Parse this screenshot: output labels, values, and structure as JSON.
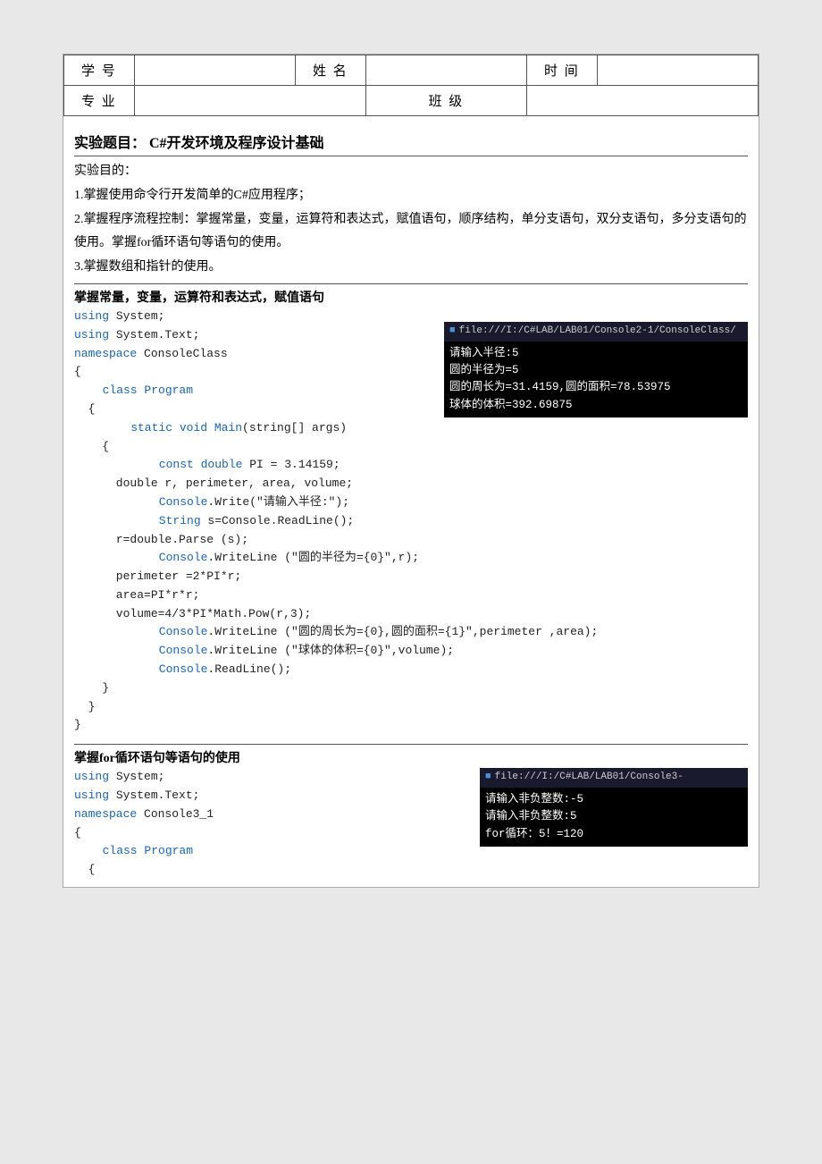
{
  "header": {
    "row1": [
      {
        "label": "学 号",
        "value": ""
      },
      {
        "label": "姓 名",
        "value": ""
      },
      {
        "label": "时 间",
        "value": ""
      }
    ],
    "row2": [
      {
        "label": "专 业",
        "value": ""
      },
      {
        "label": "班 级",
        "value": ""
      }
    ]
  },
  "experiment": {
    "title": "实验题目： C#开发环境及程序设计基础",
    "objectives_title": "实验目的：",
    "objectives": [
      "1.掌握使用命令行开发简单的C#应用程序；",
      "2.掌握程序流程控制：掌握常量，变量，运算符和表达式，赋值语句，顺序结构，单分支语句，双分支语句，多分支语句的使用。掌握for循环语句等语句的使用。",
      "3.掌握数组和指针的使用。"
    ]
  },
  "section1": {
    "title": "掌握常量，变量，运算符和表达式，赋值语句",
    "code_lines": [
      {
        "type": "kw",
        "text": "using"
      },
      {
        "type": "black",
        "text": " System;"
      },
      {
        "type": "kw",
        "text": "using"
      },
      {
        "type": "black",
        "text": " System.Text;"
      },
      {
        "type": "kw",
        "text": "namespace"
      },
      {
        "type": "black",
        "text": " ConsoleClass"
      },
      {
        "type": "black",
        "text": "{"
      },
      {
        "type": "kw_indent2",
        "text": "class Program"
      },
      {
        "type": "black",
        "text": "  {"
      },
      {
        "type": "kw_indent4",
        "text": "    static void Main(string[] args)"
      },
      {
        "type": "black",
        "text": "    {"
      },
      {
        "type": "kw_indent6",
        "text": "      const double"
      },
      {
        "type": "black_inline",
        "text": " PI = 3.14159;"
      },
      {
        "type": "black",
        "text": "      double r, perimeter, area, volume;"
      },
      {
        "type": "kw_inline6",
        "text": "      Console"
      },
      {
        "type": "black_inline2",
        "text": ".Write(\"请输入半径:\");"
      },
      {
        "type": "kw_inline6",
        "text": "      String"
      },
      {
        "type": "black_inline2",
        "text": " s=Console.ReadLine();"
      },
      {
        "type": "black",
        "text": "      r=double.Parse (s);"
      },
      {
        "type": "kw_inline6",
        "text": "      Console"
      },
      {
        "type": "black_inline2",
        "text": ".WriteLine (\"圆的半径为={0}\",r);"
      },
      {
        "type": "black",
        "text": "      perimeter =2*PI*r;"
      },
      {
        "type": "black",
        "text": "      area=PI*r*r;"
      },
      {
        "type": "black",
        "text": "      volume=4/3*PI*Math.Pow(r,3);"
      },
      {
        "type": "kw_inline6",
        "text": "      Console"
      },
      {
        "type": "black_inline2",
        "text": ".WriteLine (\"圆的周长为={0},圆的面积={1}\",perimeter ,area);"
      },
      {
        "type": "kw_inline6",
        "text": "      Console"
      },
      {
        "type": "black_inline2",
        "text": ".WriteLine (\"球体的体积={0}\",volume);"
      },
      {
        "type": "kw_inline6",
        "text": "      Console"
      },
      {
        "type": "black_inline2",
        "text": ".ReadLine();"
      },
      {
        "type": "black",
        "text": "    }"
      },
      {
        "type": "black",
        "text": "  }"
      },
      {
        "type": "black",
        "text": "}"
      }
    ],
    "console1": {
      "title": "file:///I:/C#LAB/LAB01/Console2-1/ConsoleClass/",
      "lines": [
        "请输入半径:5",
        "圆的半径为=5",
        "圆的周长为=31.4159,圆的面积=78.53975",
        "球体的体积=392.69875"
      ]
    }
  },
  "section2": {
    "title": "掌握for循环语句等语句的使用",
    "code_lines_before": [
      "using System;",
      "using System.Text;",
      "namespace Console3_1",
      "{",
      "  class Program",
      "  {"
    ],
    "console2": {
      "title": "file:///I:/C#LAB/LAB01/Console3-",
      "lines": [
        "请输入非负整数:-5",
        "请输入非负整数:5",
        "for循环：5！=120"
      ]
    }
  }
}
